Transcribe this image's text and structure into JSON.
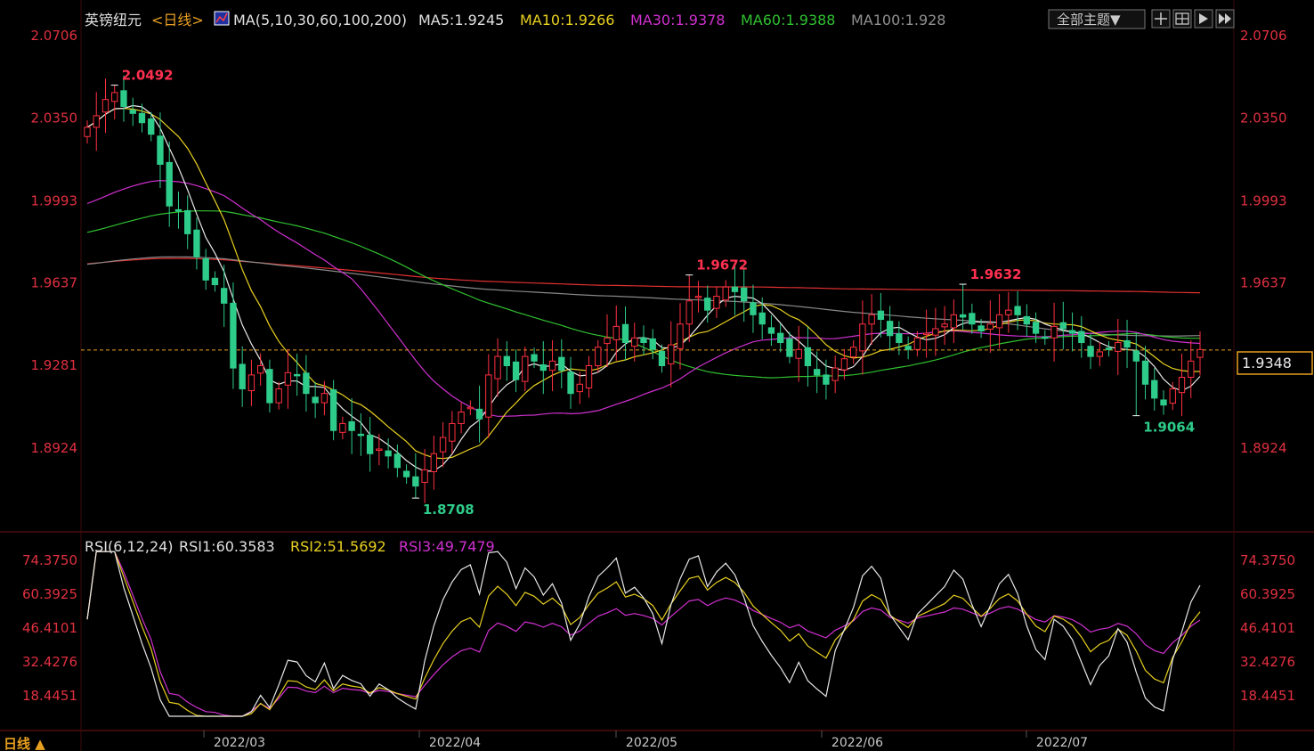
{
  "header": {
    "symbol": "英镑纽元",
    "period": "<日线>",
    "ma_label": "MA(5,10,30,60,100,200)",
    "ma5": "MA5:1.9245",
    "ma10": "MA10:1.9266",
    "ma30": "MA30:1.9378",
    "ma60": "MA60:1.9388",
    "ma100": "MA100:1.928",
    "theme_button": "全部主题▼"
  },
  "rsi_header": {
    "label": "RSI(6,12,24)",
    "rsi1": "RSI1:60.3583",
    "rsi2": "RSI2:51.5692",
    "rsi3": "RSI3:49.7479"
  },
  "footer": {
    "period_button": "日线 ▲"
  },
  "colors": {
    "up": "#ff3040",
    "down": "#2ecc8a",
    "ma5": "#e8e8e8",
    "ma10": "#e8d020",
    "ma30": "#d030d0",
    "ma60": "#30c030",
    "ma100": "#888888",
    "ma200": "#e03030",
    "axis_text": "#e03040"
  },
  "chart_data": [
    {
      "type": "candlestick",
      "title": "英镑纽元 日线",
      "y_ticks": [
        "2.0706",
        "2.0350",
        "1.9993",
        "1.9637",
        "1.9281",
        "1.8924"
      ],
      "ylim": [
        1.862,
        2.079
      ],
      "x_ticks": [
        "2022/03",
        "2022/04",
        "2022/05",
        "2022/06",
        "2022/07"
      ],
      "current_price": "1.9348",
      "annotations": [
        {
          "label": "2.0492",
          "value": 2.0492,
          "kind": "high"
        },
        {
          "label": "1.8708",
          "value": 1.8708,
          "kind": "low"
        },
        {
          "label": "1.9672",
          "value": 1.9672,
          "kind": "high"
        },
        {
          "label": "1.9632",
          "value": 1.9632,
          "kind": "high"
        },
        {
          "label": "1.9064",
          "value": 1.9064,
          "kind": "low"
        }
      ],
      "close": [
        2.031,
        2.036,
        2.043,
        2.046,
        2.04,
        2.037,
        2.033,
        2.028,
        2.015,
        1.997,
        1.995,
        1.985,
        1.975,
        1.965,
        1.963,
        1.955,
        1.927,
        1.918,
        1.924,
        1.928,
        1.912,
        1.918,
        1.925,
        1.924,
        1.916,
        1.912,
        1.916,
        1.9,
        1.903,
        1.9,
        1.898,
        1.89,
        1.892,
        1.889,
        1.884,
        1.88,
        1.876,
        1.883,
        1.89,
        1.897,
        1.903,
        1.908,
        1.91,
        1.905,
        1.924,
        1.932,
        1.928,
        1.922,
        1.932,
        1.93,
        1.926,
        1.93,
        1.926,
        1.916,
        1.92,
        1.928,
        1.936,
        1.94,
        1.945,
        1.938,
        1.94,
        1.938,
        1.935,
        1.928,
        1.937,
        1.946,
        1.956,
        1.958,
        1.952,
        1.958,
        1.962,
        1.96,
        1.956,
        1.95,
        1.946,
        1.942,
        1.938,
        1.932,
        1.935,
        1.928,
        1.924,
        1.92,
        1.927,
        1.931,
        1.936,
        1.946,
        1.95,
        1.948,
        1.941,
        1.938,
        1.935,
        1.94,
        1.942,
        1.944,
        1.946,
        1.95,
        1.949,
        1.946,
        1.943,
        1.946,
        1.95,
        1.952,
        1.95,
        1.946,
        1.942,
        1.94,
        1.945,
        1.944,
        1.942,
        1.938,
        1.932,
        1.934,
        1.935,
        1.938,
        1.936,
        1.93,
        1.92,
        1.914,
        1.911,
        1.918,
        1.923,
        1.93,
        1.935
      ],
      "rsi_ticks": [
        "74.3750",
        "60.3925",
        "46.4101",
        "32.4276",
        "18.4451"
      ],
      "rsi_ylim": [
        10.0,
        78.0
      ],
      "rsi_series": [
        {
          "name": "RSI1",
          "period": 6,
          "last": 60.3583
        },
        {
          "name": "RSI2",
          "period": 12,
          "last": 51.5692
        },
        {
          "name": "RSI3",
          "period": 24,
          "last": 49.7479
        }
      ]
    }
  ]
}
